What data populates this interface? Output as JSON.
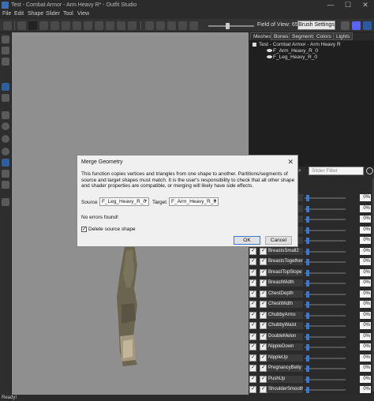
{
  "window": {
    "title": "Test - Combat Armor - Arm Heavy R* - Outfit Studio",
    "minimize": "—",
    "maximize": "☐",
    "close": "✕"
  },
  "menu": [
    "File",
    "Edit",
    "Shape",
    "Slider",
    "Tool",
    "View"
  ],
  "toolbar": {
    "field_of_view_label": "Field of View: 65",
    "brush_settings_label": "Brush Settings"
  },
  "tabs": [
    "Meshes",
    "Bones",
    "Segments",
    "Colors",
    "Lights"
  ],
  "tree": {
    "root": "Test - Combat Armor - Arm Heavy R",
    "items": [
      "F_Arm_Heavy_R_0",
      "F_Leg_Heavy_R_0"
    ],
    "selected_index": 1
  },
  "slider_filter": {
    "placeholder": "Slider Filter"
  },
  "sliders": [
    {
      "label": "",
      "value": "0%"
    },
    {
      "label": "",
      "value": "0%"
    },
    {
      "label": "",
      "value": "0%"
    },
    {
      "label": "",
      "value": "0%"
    },
    {
      "label": "",
      "value": "0%"
    },
    {
      "label": "BreastsSmall2",
      "value": "0%"
    },
    {
      "label": "BreastsTogether",
      "value": "0%"
    },
    {
      "label": "BreastTopSlope",
      "value": "0%"
    },
    {
      "label": "BreastWidth",
      "value": "0%"
    },
    {
      "label": "ChestDepth",
      "value": "0%"
    },
    {
      "label": "ChestWidth",
      "value": "0%"
    },
    {
      "label": "ChubbyArms",
      "value": "0%"
    },
    {
      "label": "ChubbyWaist",
      "value": "0%"
    },
    {
      "label": "DoubleMelon",
      "value": "0%"
    },
    {
      "label": "NippleDown",
      "value": "0%"
    },
    {
      "label": "NippleUp",
      "value": "0%"
    },
    {
      "label": "PregnancyBelly",
      "value": "0%"
    },
    {
      "label": "PushUp",
      "value": "0%"
    },
    {
      "label": "ShoulderSmooth",
      "value": "0%"
    }
  ],
  "status": "Ready!",
  "dialog": {
    "title": "Merge Geometry",
    "close": "✕",
    "description": "This function copies vertices and triangles from one shape to another.  Partitions/segments of source and target shapes must match.  It is the user's responsibility to check that all other shape and shader properties are compatible, or merging will likely have side effects.",
    "source_label": "Source",
    "source_value": "F_Leg_Heavy_R_0",
    "target_label": "Target",
    "target_value": "F_Arm_Heavy_R_0",
    "status": "No errors found!",
    "delete_source_label": "Delete source shape",
    "ok_label": "OK",
    "cancel_label": "Cancel"
  },
  "colors": {
    "accent": "#3a78d0",
    "viewport": "#8f8f8f",
    "panel": "#2a2a2a"
  }
}
